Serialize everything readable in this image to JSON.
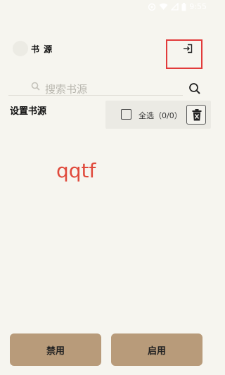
{
  "status_bar": {
    "time": "9:55",
    "icons": [
      "settings-icon",
      "wifi-icon",
      "signal-icon",
      "battery-icon"
    ]
  },
  "header": {
    "title": "书 源",
    "back_icon": "back-icon",
    "import_icon": "import-icon"
  },
  "search": {
    "placeholder": "搜索书源",
    "icon": "search-icon"
  },
  "section": {
    "title": "设置书源"
  },
  "selection": {
    "label": "全选（0/0）",
    "checked": false,
    "delete_icon": "delete-icon"
  },
  "overlay": {
    "text": "qqtf",
    "color": "#e04a3c"
  },
  "actions": {
    "disable_label": "禁用",
    "enable_label": "启用"
  },
  "colors": {
    "background": "#f6f5ef",
    "button": "#b89b7a",
    "highlight": "#e23b3b"
  }
}
